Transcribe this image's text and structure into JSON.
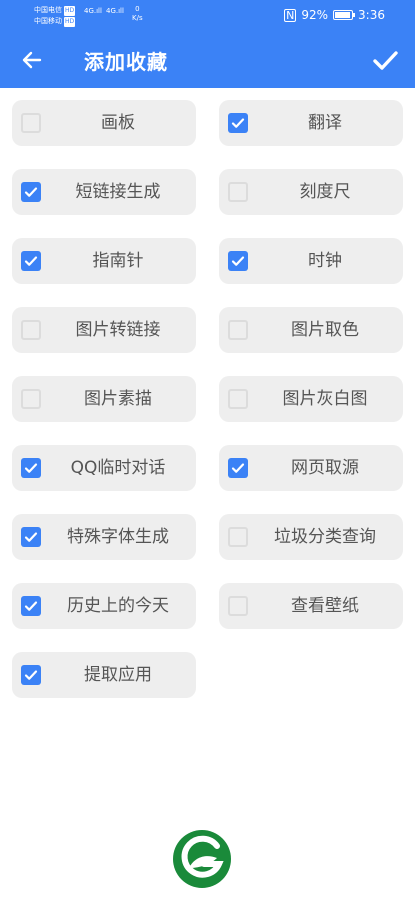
{
  "status": {
    "carrier1": "中国电信",
    "carrier2": "中国移动",
    "hd": "HD",
    "net1": "4G",
    "net2": "4G",
    "speed_value": "0",
    "speed_unit": "K/s",
    "battery": "92%",
    "time": "3:36"
  },
  "header": {
    "title": "添加收藏"
  },
  "items": [
    {
      "label": "画板",
      "checked": false
    },
    {
      "label": "翻译",
      "checked": true
    },
    {
      "label": "短链接生成",
      "checked": true
    },
    {
      "label": "刻度尺",
      "checked": false
    },
    {
      "label": "指南针",
      "checked": true
    },
    {
      "label": "时钟",
      "checked": true
    },
    {
      "label": "图片转链接",
      "checked": false
    },
    {
      "label": "图片取色",
      "checked": false
    },
    {
      "label": "图片素描",
      "checked": false
    },
    {
      "label": "图片灰白图",
      "checked": false
    },
    {
      "label": "QQ临时对话",
      "checked": true
    },
    {
      "label": "网页取源",
      "checked": true
    },
    {
      "label": "特殊字体生成",
      "checked": true
    },
    {
      "label": "垃圾分类查询",
      "checked": false
    },
    {
      "label": "历史上的今天",
      "checked": true
    },
    {
      "label": "查看壁纸",
      "checked": false
    },
    {
      "label": "提取应用",
      "checked": true
    }
  ],
  "colors": {
    "accent": "#3b82f6",
    "logo": "#1a8a3a"
  }
}
